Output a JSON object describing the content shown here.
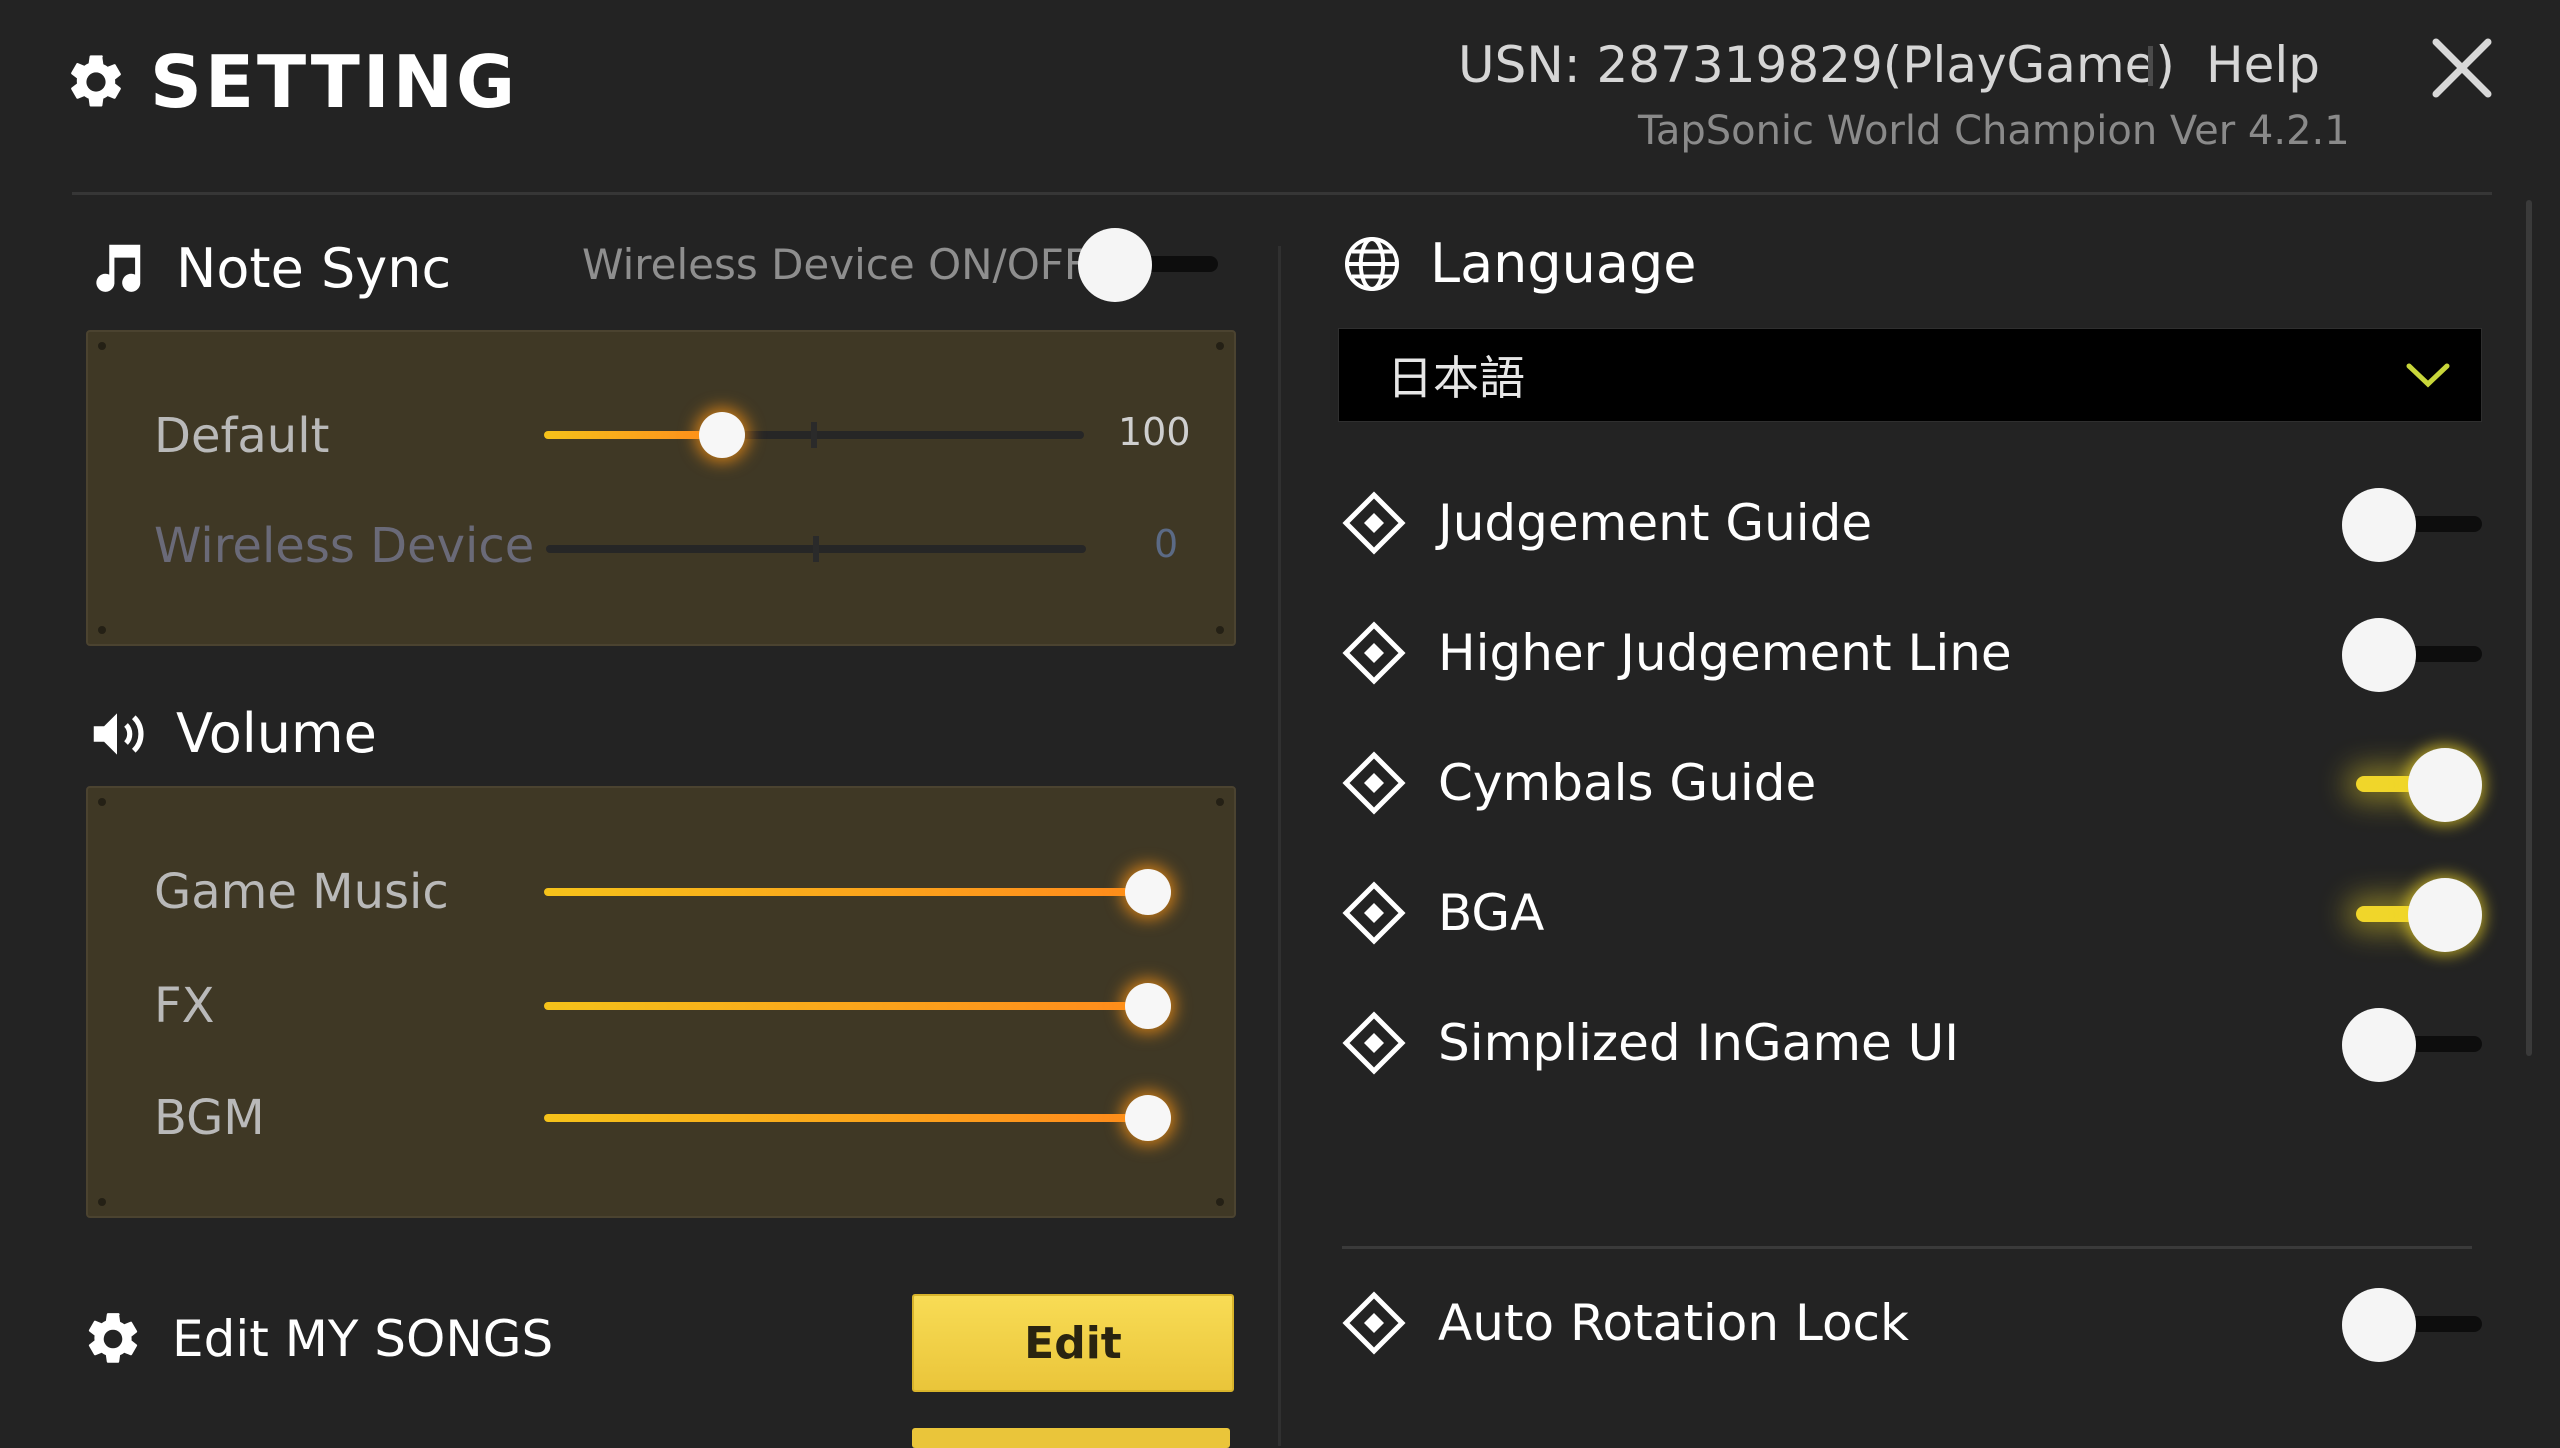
{
  "header": {
    "title": "SETTING",
    "usn": "USN: 287319829(PlayGame)",
    "help": "Help",
    "version": "TapSonic World Champion  Ver 4.2.1"
  },
  "note_sync": {
    "title": "Note Sync",
    "wireless_label": "Wireless Device  ON/OFF",
    "wireless_on": false,
    "default_label": "Default",
    "default_value": "100",
    "default_fraction": 0.33,
    "wireless_device_label": "Wireless Device",
    "wireless_device_value": "0",
    "wireless_device_fraction": 0
  },
  "volume": {
    "title": "Volume",
    "game_music_label": "Game Music",
    "game_music_fraction": 1.0,
    "fx_label": "FX",
    "fx_fraction": 1.0,
    "bgm_label": "BGM",
    "bgm_fraction": 1.0
  },
  "my_songs": {
    "title": "Edit MY SONGS",
    "edit_label": "Edit"
  },
  "language": {
    "title": "Language",
    "selected": "日本語"
  },
  "options": [
    {
      "label": "Judgement Guide",
      "on": false
    },
    {
      "label": "Higher Judgement Line",
      "on": false
    },
    {
      "label": "Cymbals Guide",
      "on": true
    },
    {
      "label": "BGA",
      "on": true
    },
    {
      "label": "Simplized InGame UI",
      "on": false
    }
  ],
  "options2": [
    {
      "label": "Auto Rotation Lock",
      "on": false
    }
  ],
  "colors": {
    "background": "#232323",
    "panel": "#3f3825",
    "accent_yellow": "#f0d62a",
    "slider_orange": "#ff8a1c",
    "button": "#eac53a"
  }
}
